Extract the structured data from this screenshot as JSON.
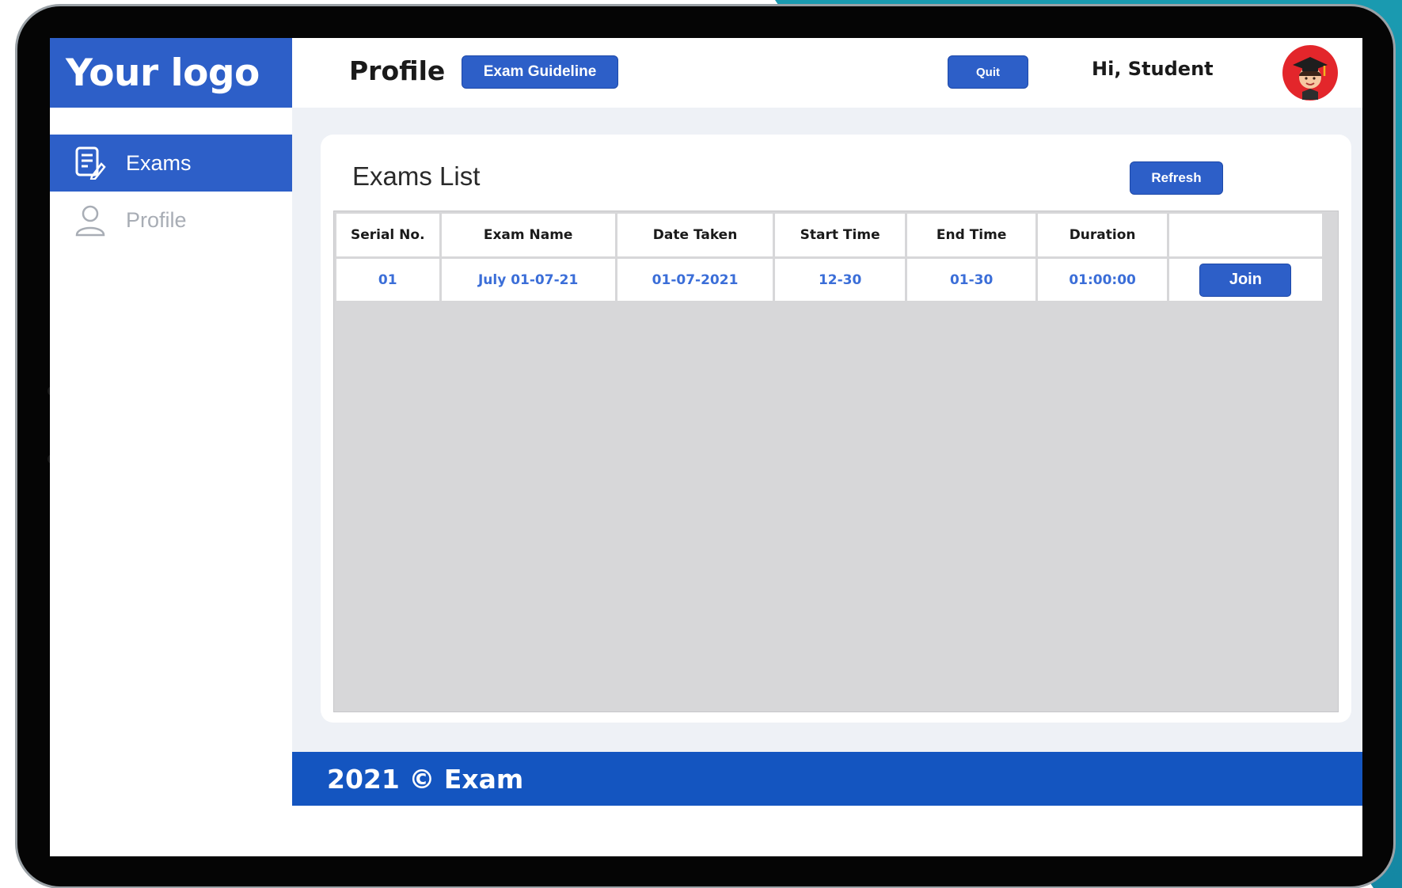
{
  "brand": {
    "logo_text": "Your logo"
  },
  "sidebar": {
    "items": [
      {
        "label": "Exams",
        "icon": "exam-document-icon",
        "active": true
      },
      {
        "label": "Profile",
        "icon": "user-icon",
        "active": false
      }
    ]
  },
  "header": {
    "title": "Profile",
    "guideline_label": "Exam Guideline",
    "quit_label": "Quit",
    "greeting": "Hi, Student",
    "avatar_icon": "student-graduate-avatar-icon"
  },
  "exams": {
    "title": "Exams List",
    "refresh_label": "Refresh",
    "columns": [
      "Serial No.",
      "Exam Name",
      "Date Taken",
      "Start Time",
      "End Time",
      "Duration",
      ""
    ],
    "rows": [
      {
        "serial": "01",
        "name": "July 01-07-21",
        "date": "01-07-2021",
        "start": "12-30",
        "end": "01-30",
        "duration": "01:00:00",
        "action": "Join"
      }
    ]
  },
  "footer": {
    "text": "2021 © Exam"
  },
  "colors": {
    "primary": "#2d5fc8",
    "footer": "#1455c0",
    "link_text": "#3b6ed8",
    "content_bg": "#eef1f6",
    "table_bg": "#d7d7d9"
  }
}
